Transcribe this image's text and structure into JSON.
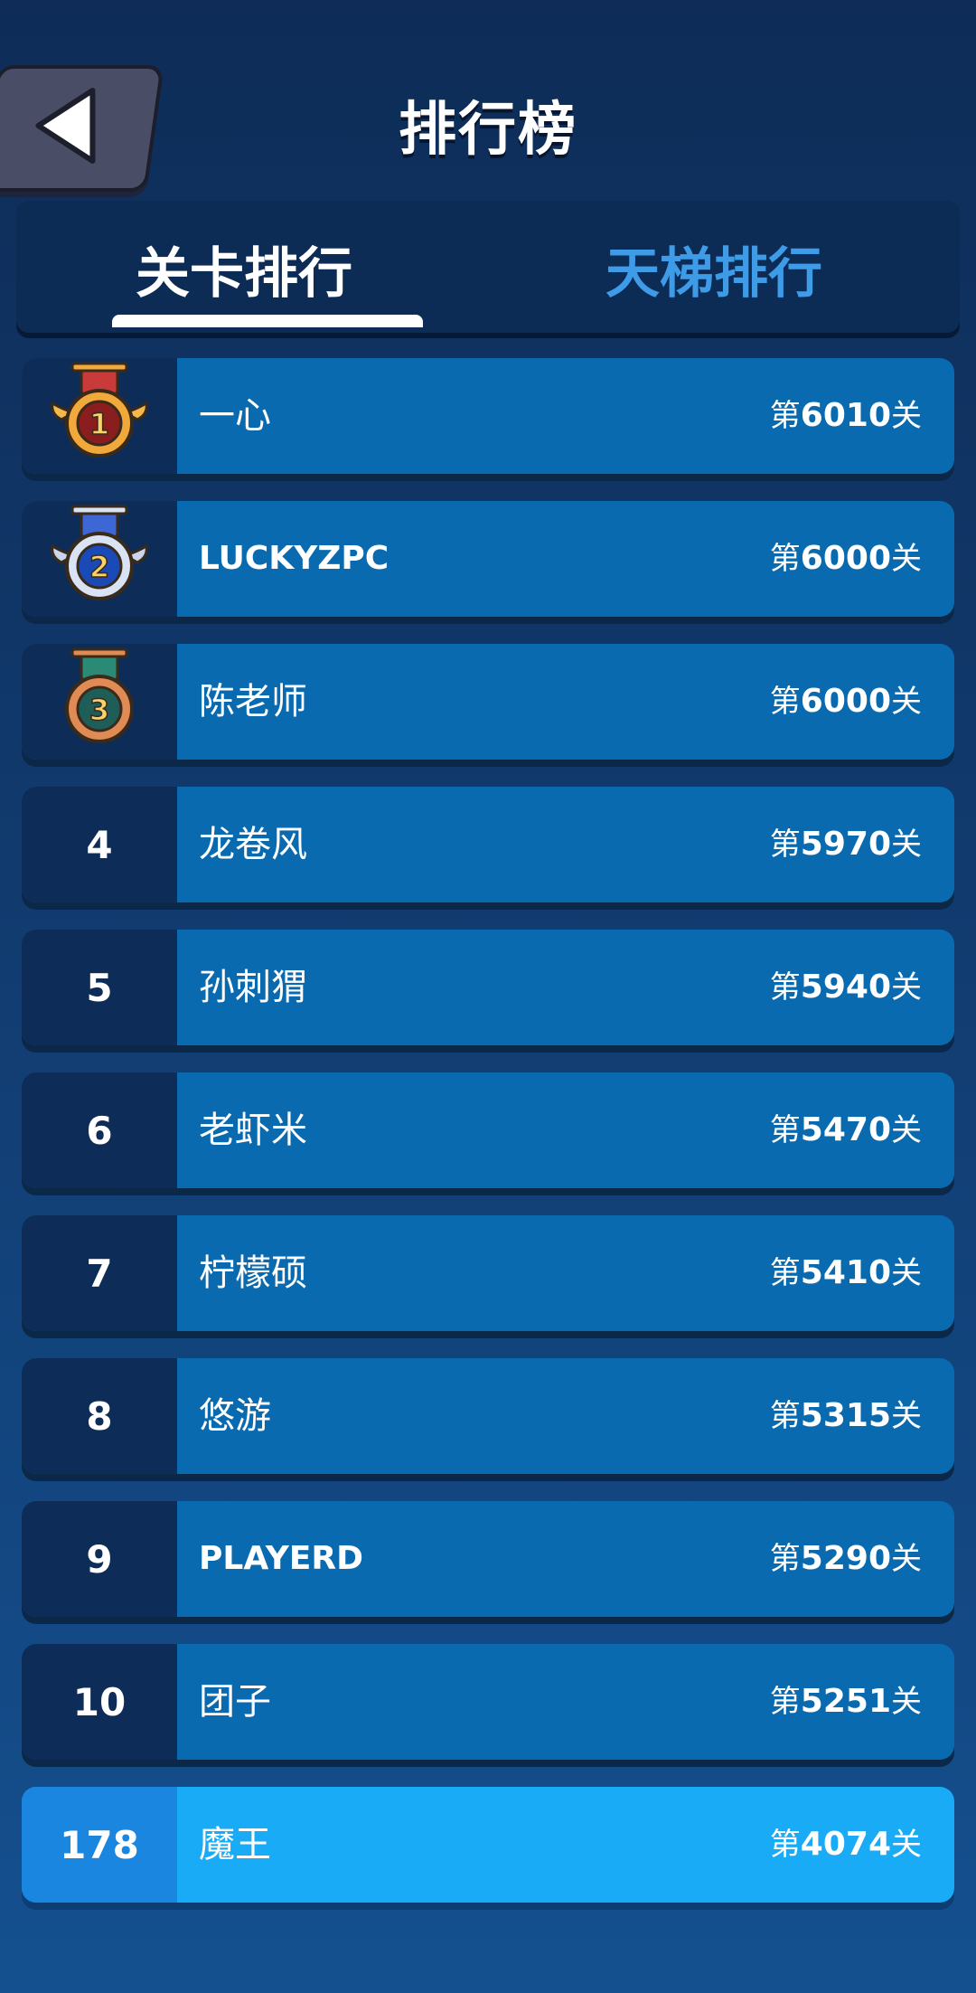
{
  "header": {
    "title": "排行榜",
    "back_icon": "back-arrow-icon"
  },
  "tabs": [
    {
      "label": "关卡排行",
      "active": true
    },
    {
      "label": "天梯排行",
      "active": false
    }
  ],
  "level_format": {
    "prefix": "第",
    "suffix": "关"
  },
  "colors": {
    "gold": "#c94a2c",
    "silver": "#3b6fd6",
    "bronze": "#2b8c76",
    "highlight": "#19abf5"
  },
  "rows": [
    {
      "rank": "1",
      "medal": "gold-medal-icon",
      "name": "一心",
      "level": "6010"
    },
    {
      "rank": "2",
      "medal": "silver-medal-icon",
      "name": "LUCKYZPC",
      "level": "6000"
    },
    {
      "rank": "3",
      "medal": "bronze-medal-icon",
      "name": "陈老师",
      "level": "6000"
    },
    {
      "rank": "4",
      "name": "龙卷风",
      "level": "5970"
    },
    {
      "rank": "5",
      "name": "孙刺猬",
      "level": "5940"
    },
    {
      "rank": "6",
      "name": "老虾米",
      "level": "5470"
    },
    {
      "rank": "7",
      "name": "柠檬硕",
      "level": "5410"
    },
    {
      "rank": "8",
      "name": "悠游",
      "level": "5315"
    },
    {
      "rank": "9",
      "name": "PLAYERD",
      "level": "5290"
    },
    {
      "rank": "10",
      "name": "团子",
      "level": "5251"
    },
    {
      "rank": "178",
      "name": "魔王",
      "level": "4074",
      "is_me": true
    }
  ]
}
